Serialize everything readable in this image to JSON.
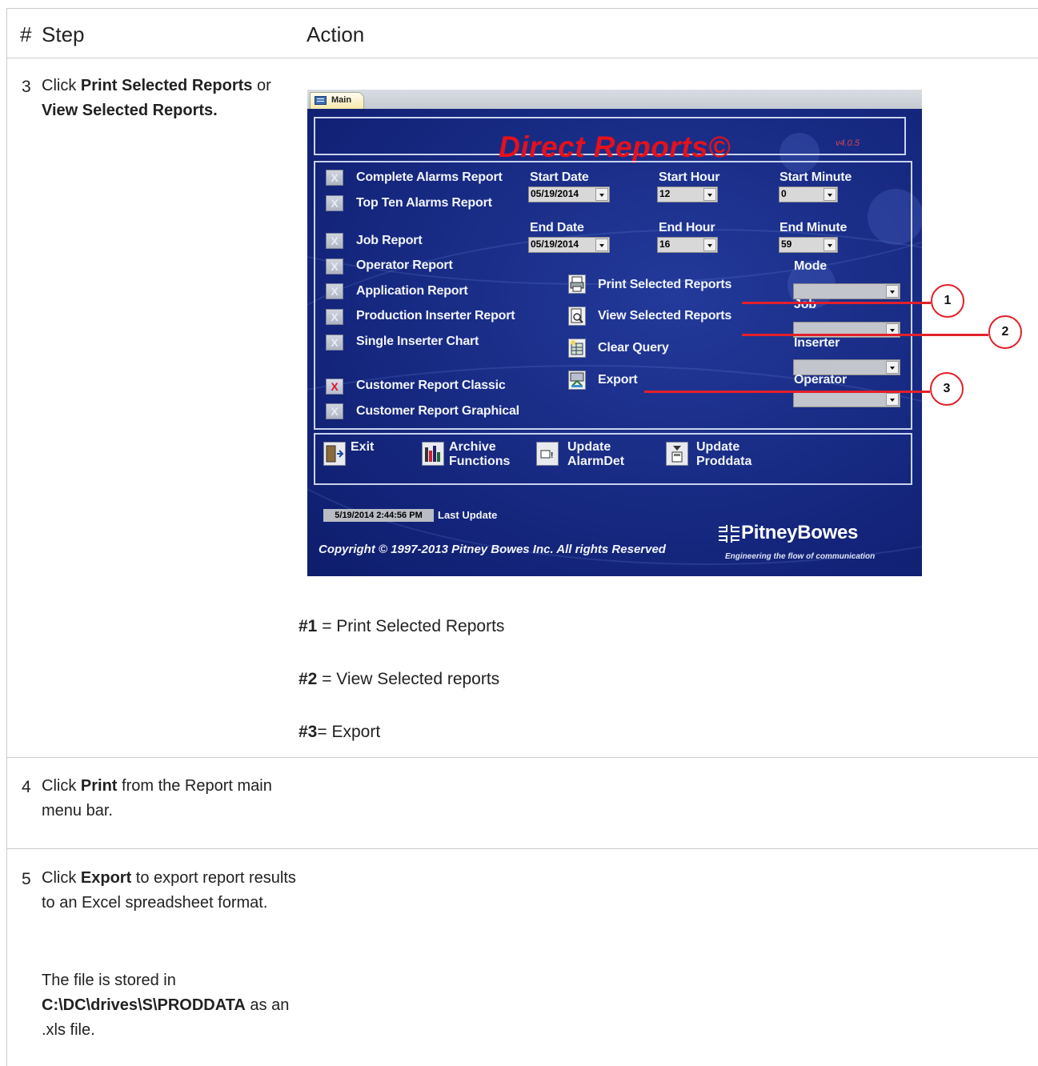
{
  "table": {
    "headers": {
      "num": "#",
      "step": "Step",
      "action": "Action"
    },
    "rows": [
      {
        "num": "3"
      },
      {
        "num": "4"
      },
      {
        "num": "5"
      }
    ]
  },
  "row3": {
    "text_1": "Click ",
    "bold_1": "Print Selected Reports",
    "text_2": " or ",
    "bold_2": "View Selected Reports."
  },
  "row4": {
    "text_1": "Click ",
    "bold_1": "Print",
    "text_2": " from the Report main menu bar."
  },
  "row5": {
    "text_1": "Click ",
    "bold_1": "Export",
    "text_2": " to export report results to an Excel spreadsheet format.",
    "p2_text_1": "The file is stored in ",
    "p2_bold": "C:\\DC\\drives\\S\\PRODDATA",
    "p2_text_2": " as an .xls file."
  },
  "legend": [
    {
      "key": "#1",
      "sep": " = ",
      "value": "Print Selected Reports"
    },
    {
      "key": "#2",
      "sep": " = ",
      "value": "View Selected reports"
    },
    {
      "key": "#3",
      "sep": "= ",
      "value": "Export"
    }
  ],
  "app": {
    "tab": "Main",
    "title": "Direct Reports©",
    "version": "v4.0.5",
    "reports": [
      {
        "label": "Complete Alarms Report",
        "checked": false
      },
      {
        "label": "Top Ten Alarms Report",
        "checked": false
      },
      {
        "label": "Job Report",
        "checked": false
      },
      {
        "label": "Operator Report",
        "checked": false
      },
      {
        "label": "Application Report",
        "checked": false
      },
      {
        "label": "Production Inserter Report",
        "checked": false
      },
      {
        "label": "Single Inserter Chart",
        "checked": false
      },
      {
        "label": "Customer Report Classic",
        "checked": true
      },
      {
        "label": "Customer Report Graphical",
        "checked": false
      }
    ],
    "checkbox_mark": "X",
    "fields": {
      "start_date": {
        "label": "Start Date",
        "value": "05/19/2014"
      },
      "start_hour": {
        "label": "Start Hour",
        "value": "12"
      },
      "start_minute": {
        "label": "Start Minute",
        "value": "0"
      },
      "end_date": {
        "label": "End Date",
        "value": "05/19/2014"
      },
      "end_hour": {
        "label": "End Hour",
        "value": "16"
      },
      "end_minute": {
        "label": "End Minute",
        "value": "59"
      },
      "mode": {
        "label": "Mode",
        "value": ""
      },
      "job": {
        "label": "Job",
        "value": ""
      },
      "inserter": {
        "label": "Inserter",
        "value": ""
      },
      "operator": {
        "label": "Operator",
        "value": ""
      }
    },
    "actions": {
      "print": "Print Selected Reports",
      "view": "View Selected Reports",
      "clear": "Clear Query",
      "export": "Export"
    },
    "bottom": {
      "exit": "Exit",
      "archive_1": "Archive",
      "archive_2": "Functions",
      "alarm_1": "Update",
      "alarm_2": "AlarmDet",
      "prod_1": "Update",
      "prod_2": "Proddata"
    },
    "last_update_value": "5/19/2014 2:44:56 PM",
    "last_update_label": "Last Update",
    "copyright": "Copyright © 1997-2013 Pitney Bowes Inc. All rights Reserved",
    "brand": "PitneyBowes",
    "brand_tagline": "Engineering the flow of communication",
    "callouts": [
      "1",
      "2",
      "3"
    ],
    "colors": {
      "panel_bg": "#13247a",
      "title_red": "#e5111b",
      "callout_red": "#e3202a"
    }
  }
}
